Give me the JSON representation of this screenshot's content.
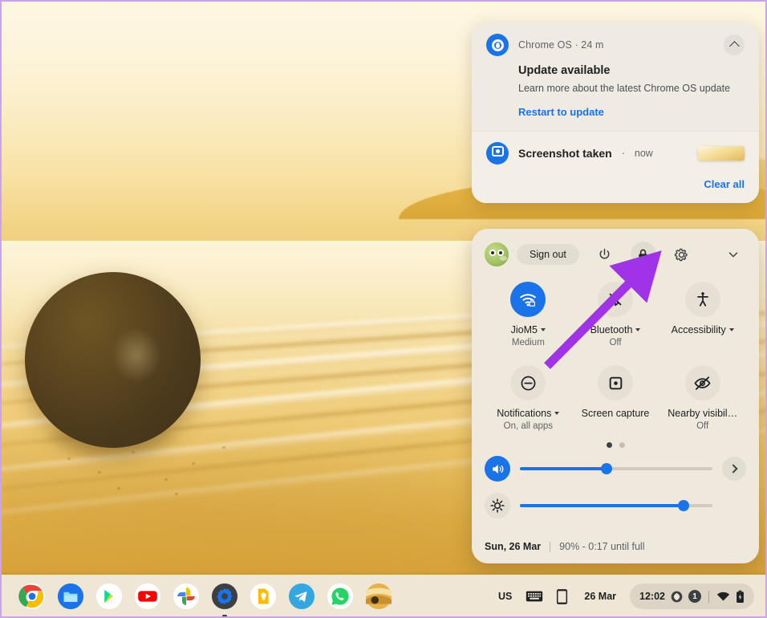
{
  "wallpaper": {
    "description": "golden sunset beach with boulder"
  },
  "notifications": {
    "items": [
      {
        "app": "Chrome OS  ·  24 m",
        "app_icon": "chrome-os-update-icon",
        "title": "Update available",
        "body": "Learn more about the latest Chrome OS update",
        "action": "Restart to update",
        "collapse_icon": "chevron-up-icon"
      },
      {
        "app_icon": "screenshot-icon",
        "title": "Screenshot taken",
        "separator": "·",
        "time": "now"
      }
    ],
    "clear_all": "Clear all"
  },
  "quick_settings": {
    "avatar": "user-avatar",
    "sign_out": "Sign out",
    "header_buttons": [
      {
        "name": "power-button",
        "icon": "power-icon"
      },
      {
        "name": "lock-button",
        "icon": "lock-icon"
      },
      {
        "name": "settings-button",
        "icon": "gear-icon"
      },
      {
        "name": "collapse-button",
        "icon": "chevron-down-icon"
      }
    ],
    "tiles": [
      {
        "icon": "wifi-icon",
        "label": "JioM5",
        "sub": "Medium",
        "state": "on",
        "has_caret": true
      },
      {
        "icon": "bluetooth-off-icon",
        "label": "Bluetooth",
        "sub": "Off",
        "state": "off",
        "has_caret": true
      },
      {
        "icon": "accessibility-icon",
        "label": "Accessibility",
        "sub": "",
        "state": "off",
        "has_caret": true
      },
      {
        "icon": "do-not-disturb-icon",
        "label": "Notifications",
        "sub": "On, all apps",
        "state": "off",
        "has_caret": true
      },
      {
        "icon": "screen-capture-icon",
        "label": "Screen capture",
        "sub": "",
        "state": "off",
        "has_caret": false
      },
      {
        "icon": "nearby-visibility-off-icon",
        "label": "Nearby visibil…",
        "sub": "Off",
        "state": "off",
        "has_caret": false
      }
    ],
    "page_dots": {
      "count": 2,
      "active_index": 0
    },
    "volume_slider": {
      "icon": "volume-icon",
      "value": 45
    },
    "brightness_slider": {
      "icon": "brightness-icon",
      "value": 85
    },
    "next_page_icon": "chevron-right-icon",
    "footer": {
      "date": "Sun, 26 Mar",
      "battery": "90% - 0:17 until full"
    }
  },
  "annotation": {
    "type": "arrow",
    "color": "#a033e8",
    "points_to": "lock-button"
  },
  "shelf": {
    "apps": [
      {
        "name": "chrome",
        "active": false
      },
      {
        "name": "files",
        "active": false
      },
      {
        "name": "play-store",
        "active": false
      },
      {
        "name": "youtube",
        "active": false
      },
      {
        "name": "google-photos",
        "active": false
      },
      {
        "name": "settings",
        "active": true
      },
      {
        "name": "google-keep",
        "active": false
      },
      {
        "name": "telegram",
        "active": false
      },
      {
        "name": "whatsapp",
        "active": false
      },
      {
        "name": "screenshot-thumbnail",
        "active": false
      }
    ],
    "status": {
      "keyboard_layout": "US",
      "keyboard_icon": "keyboard-icon",
      "phone_hub_icon": "phone-icon",
      "date": "26 Mar",
      "time": "12:02",
      "tray_icon": "diamond-icon",
      "notification_count": "1",
      "wifi_icon": "wifi-icon",
      "battery_icon": "battery-charging-icon"
    }
  }
}
